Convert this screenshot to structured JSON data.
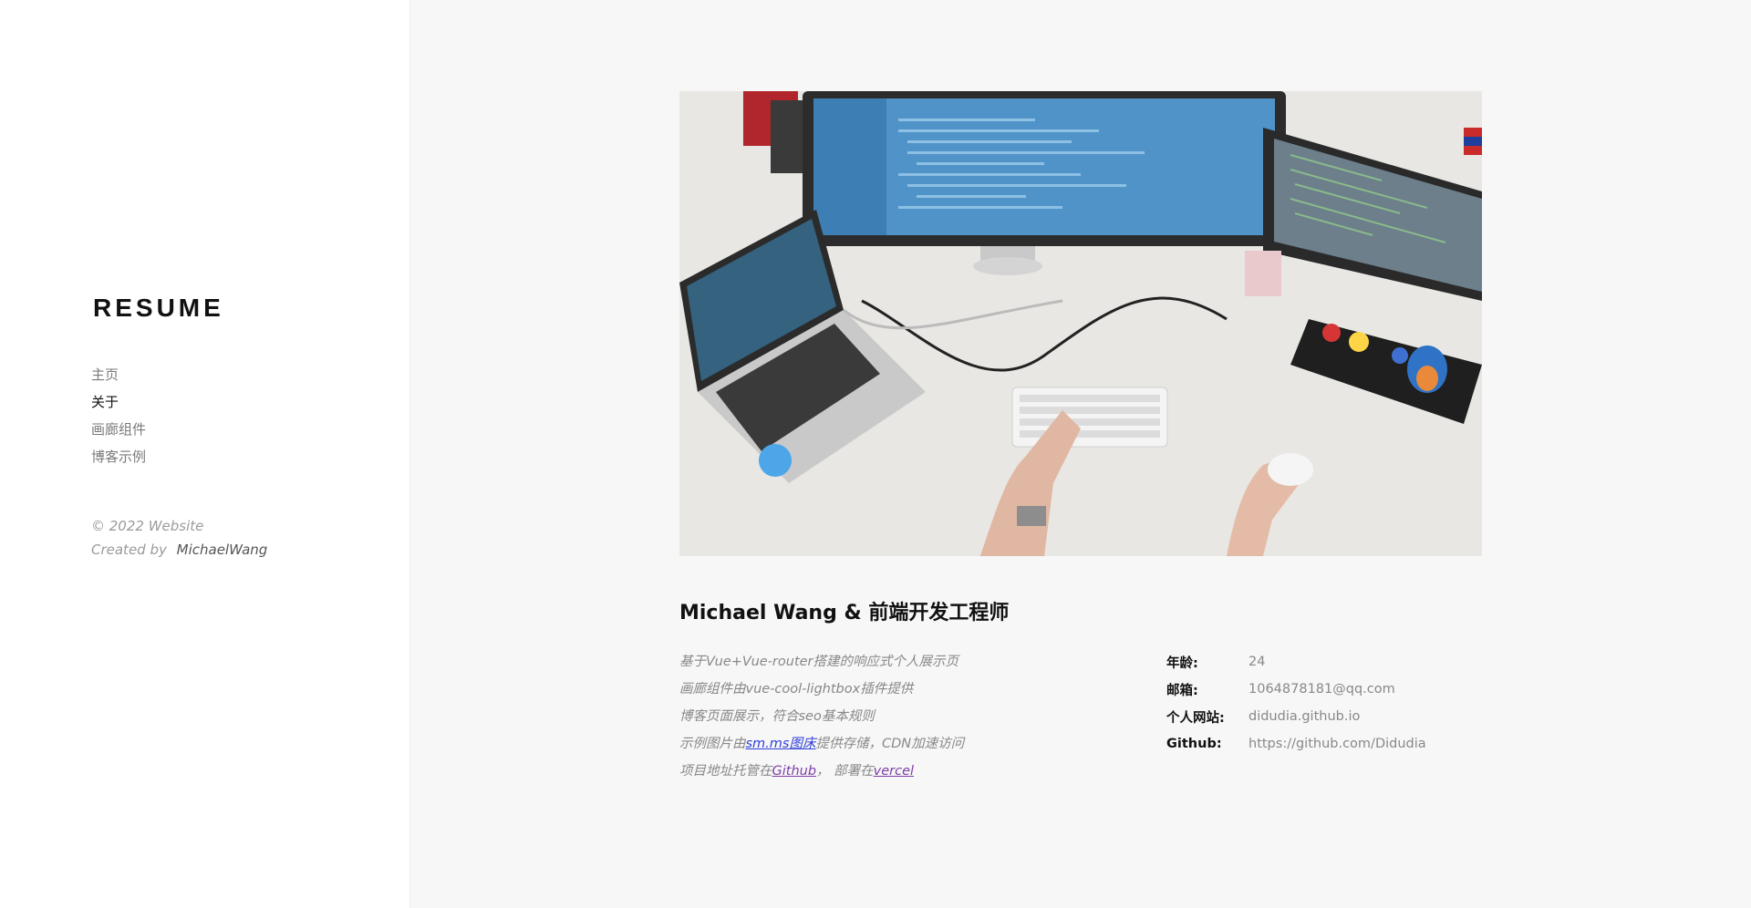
{
  "sidebar": {
    "logo": "RESUME",
    "nav": [
      {
        "label": "主页",
        "active": false
      },
      {
        "label": "关于",
        "active": true
      },
      {
        "label": "画廊组件",
        "active": false
      },
      {
        "label": "博客示例",
        "active": false
      }
    ],
    "copyright": "© 2022 Website",
    "created_by_label": "Created by",
    "author": "MichaelWang"
  },
  "main": {
    "hero_image": "desk-workspace-photo",
    "title": "Michael Wang & 前端开发工程师",
    "description": {
      "line1": "基于Vue+Vue-router搭建的响应式个人展示页",
      "line2": "画廊组件由vue-cool-lightbox插件提供",
      "line3": "博客页面展示，符合seo基本规则",
      "line4_pre": "示例图片由",
      "line4_link": "sm.ms图床",
      "line4_post": "提供存储，CDN加速访问",
      "line5_pre": "项目地址托管在",
      "line5_link1": "Github",
      "line5_mid": "，  部署在",
      "line5_link2": "vercel"
    },
    "info": [
      {
        "key": "年龄:",
        "value": "24"
      },
      {
        "key": "邮箱:",
        "value": "1064878181@qq.com"
      },
      {
        "key": "个人网站:",
        "value": "didudia.github.io"
      },
      {
        "key": "Github:",
        "value": "https://github.com/Didudia"
      }
    ]
  }
}
